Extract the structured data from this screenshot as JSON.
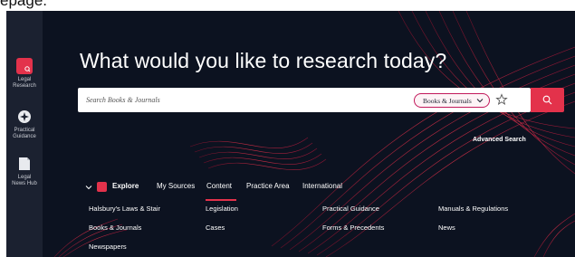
{
  "top_text": "epage.",
  "sidebar": {
    "items": [
      {
        "label_line1": "Legal",
        "label_line2": "Research",
        "icon": "legal-research-icon"
      },
      {
        "label_line1": "Practical",
        "label_line2": "Guidance",
        "icon": "practical-guidance-icon"
      },
      {
        "label_line1": "Legal",
        "label_line2": "News Hub",
        "icon": "news-hub-icon"
      }
    ]
  },
  "main": {
    "heading": "What would you like to research today?",
    "search": {
      "placeholder": "Search Books & Journals",
      "scope_label": "Books & Journals",
      "search_icon": "search-icon",
      "favorite_icon": "star-icon"
    },
    "advanced_search_label": "Advanced Search"
  },
  "nav": {
    "explore_label": "Explore",
    "tabs": [
      "My Sources",
      "Content",
      "Practice Area",
      "International"
    ],
    "active_tab": "Content"
  },
  "content_links": {
    "col1": [
      "Halsbury's Laws & Stair",
      "Books & Journals",
      "Newspapers"
    ],
    "col2": [
      "Legislation",
      "Cases"
    ],
    "col3": [
      "Practical Guidance",
      "Forms & Precedents"
    ],
    "col4": [
      "Manuals & Regulations",
      "News"
    ]
  },
  "colors": {
    "background": "#0c1220",
    "sidebar": "#1b2130",
    "accent": "#e3324b"
  }
}
